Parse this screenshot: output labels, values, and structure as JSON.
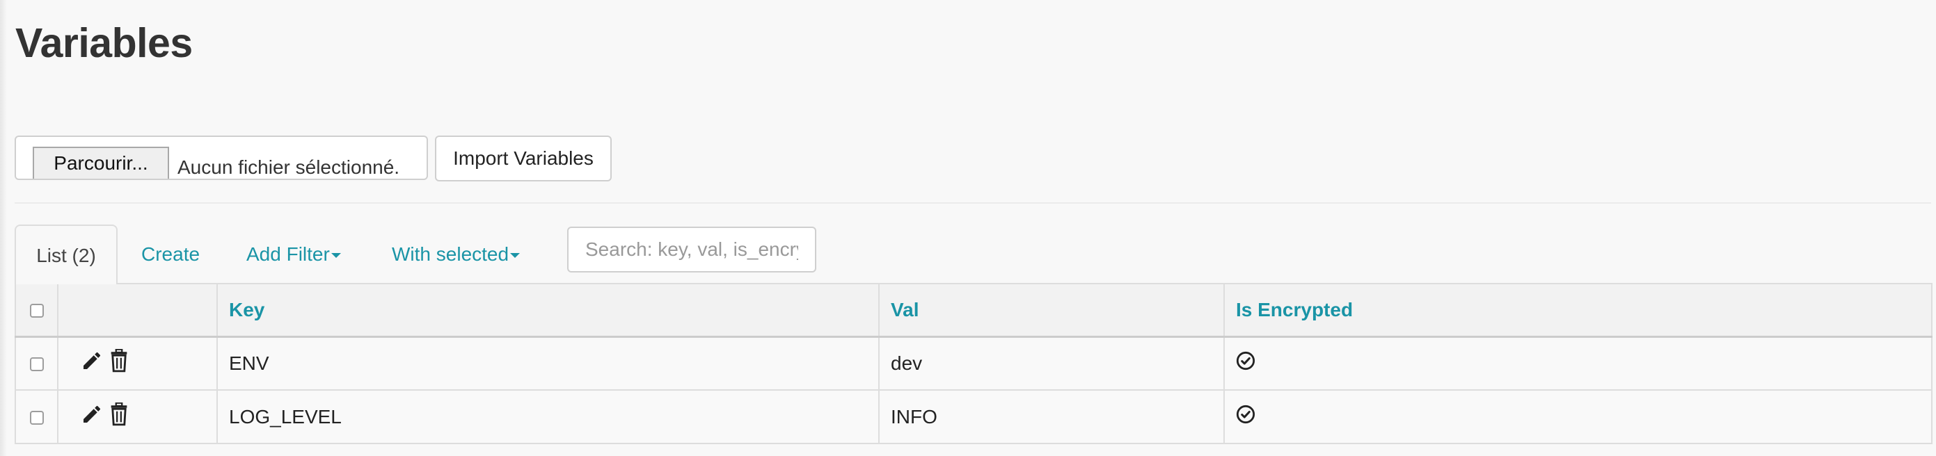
{
  "page": {
    "title": "Variables"
  },
  "import": {
    "browse_label": "Parcourir...",
    "file_status": "Aucun fichier sélectionné.",
    "import_button": "Import Variables"
  },
  "tabs": {
    "list": "List (2)",
    "create": "Create",
    "add_filter": "Add Filter",
    "with_selected": "With selected"
  },
  "search": {
    "placeholder": "Search: key, val, is_encrypted"
  },
  "table": {
    "headers": {
      "key": "Key",
      "val": "Val",
      "is_encrypted": "Is Encrypted"
    },
    "rows": [
      {
        "key": "ENV",
        "val": "dev",
        "is_encrypted": true
      },
      {
        "key": "LOG_LEVEL",
        "val": "INFO",
        "is_encrypted": true
      }
    ]
  },
  "icons": {
    "edit": "pencil-icon",
    "delete": "trash-icon",
    "encrypted": "check-circle-icon"
  },
  "colors": {
    "accent": "#1a94a6",
    "text": "#333333",
    "background": "#f8f8f8"
  }
}
